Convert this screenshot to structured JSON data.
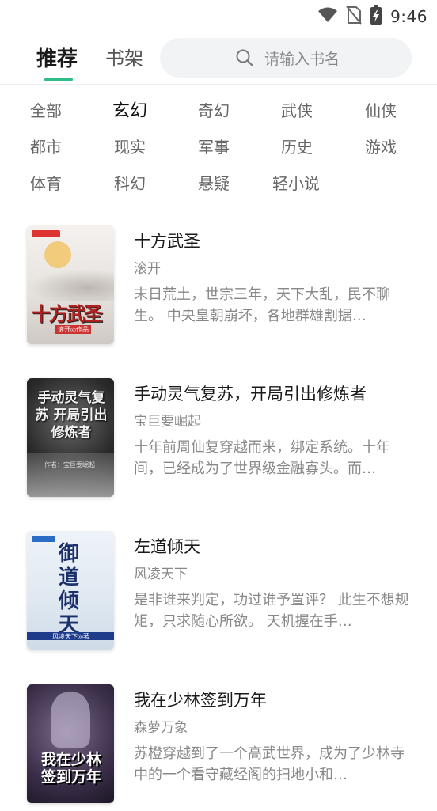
{
  "status_bar": {
    "time": "9:46"
  },
  "header": {
    "tabs": [
      "推荐",
      "书架"
    ],
    "search_placeholder": "请输入书名"
  },
  "categories": [
    [
      "全部",
      "玄幻",
      "奇幻",
      "武侠",
      "仙侠"
    ],
    [
      "都市",
      "现实",
      "军事",
      "历史",
      "游戏"
    ],
    [
      "体育",
      "科幻",
      "悬疑",
      "轻小说"
    ]
  ],
  "active_category": "玄幻",
  "books": [
    {
      "title": "十方武圣",
      "author": "滚开",
      "description": "末日荒土，世宗三年，天下大乱，民不聊生。 中央皇朝崩坏，各地群雄割据…",
      "cover_text": "十方武圣",
      "cover_sub": "滚开◎作品"
    },
    {
      "title": "手动灵气复苏，开局引出修炼者",
      "author": "宝巨要崛起",
      "description": "十年前周仙复穿越而来，绑定系统。十年间，已经成为了世界级金融寡头。而…",
      "cover_text": "手动灵气复苏 开局引出修炼者",
      "cover_sub": "作者：宝巨要崛起"
    },
    {
      "title": "左道倾天",
      "author": "风凌天下",
      "description": "是非谁来判定，功过谁予置评？ 此生不想规矩，只求随心所欲。 天机握在手…",
      "cover_text": "御道倾天",
      "cover_sub": "风凌天下◎著"
    },
    {
      "title": "我在少林签到万年",
      "author": "森萝万象",
      "description": "苏橙穿越到了一个高武世界，成为了少林寺中的一个看守藏经阁的扫地小和…",
      "cover_text": "我在少林 签到万年",
      "cover_sub": ""
    }
  ]
}
